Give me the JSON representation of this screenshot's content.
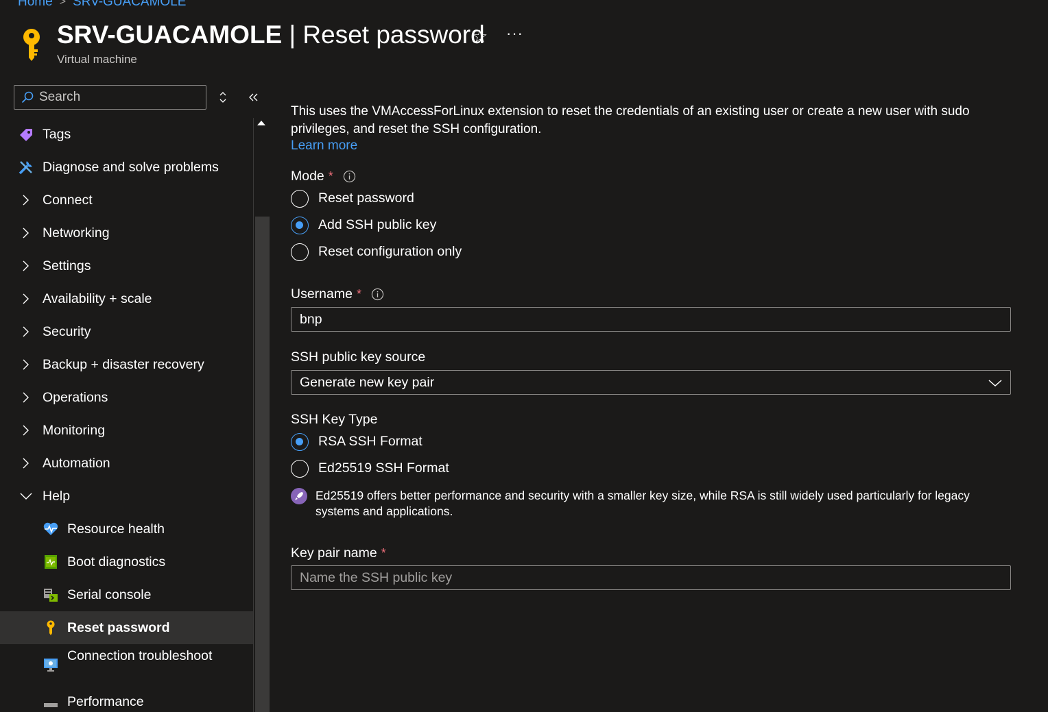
{
  "breadcrumb": {
    "home": "Home",
    "current": "SRV-GUACAMOLE"
  },
  "header": {
    "title_main": "SRV-GUACAMOLE",
    "title_rest": " | Reset password",
    "subtitle": "Virtual machine",
    "star_glyph": "☆",
    "more_glyph": "···"
  },
  "search": {
    "placeholder": "Search"
  },
  "sidebar": {
    "items": [
      {
        "label": "Tags",
        "icon": "tag-icon"
      },
      {
        "label": "Diagnose and solve problems",
        "icon": "wrench-icon"
      },
      {
        "label": "Connect",
        "icon": "chevron-right-icon"
      },
      {
        "label": "Networking",
        "icon": "chevron-right-icon"
      },
      {
        "label": "Settings",
        "icon": "chevron-right-icon"
      },
      {
        "label": "Availability + scale",
        "icon": "chevron-right-icon"
      },
      {
        "label": "Security",
        "icon": "chevron-right-icon"
      },
      {
        "label": "Backup + disaster recovery",
        "icon": "chevron-right-icon"
      },
      {
        "label": "Operations",
        "icon": "chevron-right-icon"
      },
      {
        "label": "Monitoring",
        "icon": "chevron-right-icon"
      },
      {
        "label": "Automation",
        "icon": "chevron-right-icon"
      },
      {
        "label": "Help",
        "icon": "chevron-down-icon"
      },
      {
        "label": "Resource health",
        "icon": "heart-pulse-icon"
      },
      {
        "label": "Boot diagnostics",
        "icon": "boot-diagnostics-icon"
      },
      {
        "label": "Serial console",
        "icon": "serial-console-icon"
      },
      {
        "label": "Reset password",
        "icon": "key-icon",
        "active": true
      },
      {
        "label": "Connection troubleshoot",
        "icon": "monitor-icon"
      },
      {
        "label": "Performance",
        "icon": "performance-icon"
      }
    ]
  },
  "main": {
    "intro": "This uses the VMAccessForLinux extension to reset the credentials of an existing user or create a new user with sudo privileges, and reset the SSH configuration.",
    "learn_more": "Learn more",
    "mode": {
      "label": "Mode",
      "required": "*",
      "options": [
        "Reset password",
        "Add SSH public key",
        "Reset configuration only"
      ],
      "selected": "Add SSH public key"
    },
    "username": {
      "label": "Username",
      "required": "*",
      "value": "bnp"
    },
    "key_source": {
      "label": "SSH public key source",
      "value": "Generate new key pair"
    },
    "key_type": {
      "label": "SSH Key Type",
      "options": [
        "RSA SSH Format",
        "Ed25519 SSH Format"
      ],
      "selected": "RSA SSH Format"
    },
    "note": "Ed25519 offers better performance and security with a smaller key size, while RSA is still widely used particularly for legacy systems and applications.",
    "key_pair_name": {
      "label": "Key pair name",
      "required": "*",
      "placeholder": "Name the SSH public key",
      "value": ""
    }
  },
  "colors": {
    "accent": "#479ef5",
    "required": "#f1707b",
    "background": "#1b1a19",
    "active_item": "#323130"
  }
}
